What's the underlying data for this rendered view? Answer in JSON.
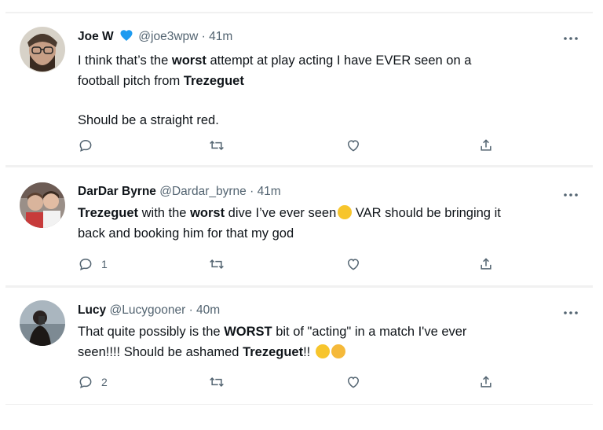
{
  "tweets": [
    {
      "name": "Joe W",
      "verified": true,
      "handle": "@joe3wpw",
      "sep": "·",
      "time": "41m",
      "line1_pre": "I think that’s the ",
      "line1_bold": "worst",
      "line1_post": " attempt at play acting I have EVER seen on a",
      "line2_pre": "football pitch from ",
      "line2_bold": "Trezeguet",
      "line3": "Should be a straight red.",
      "reply_count": "",
      "more_label": "···"
    },
    {
      "name": "DarDar Byrne",
      "verified": false,
      "handle": "@Dardar_byrne",
      "sep": "·",
      "time": "41m",
      "line1_bold1": "Trezeguet",
      "line1_mid": " with the ",
      "line1_bold2": "worst",
      "line1_post": " dive I’ve ever seen",
      "line1_emoji": "rolling-on-floor-laughing-emoji",
      "line1_end": " VAR should be bringing it",
      "line2": "back and booking him for that my god",
      "reply_count": "1",
      "more_label": "···"
    },
    {
      "name": "Lucy",
      "verified": false,
      "handle": "@Lucygooner",
      "sep": "·",
      "time": "40m",
      "line1_pre": "That quite possibly is the ",
      "line1_bold": "WORST",
      "line1_post": " bit of \"acting\" in a match I've ever",
      "line2_pre": "seen!!!! Should be ashamed ",
      "line2_bold": "Trezeguet",
      "line2_post": "!! ",
      "line2_emojis": [
        "face-screaming-emoji",
        "flushed-face-emoji"
      ],
      "reply_count": "2",
      "more_label": "···"
    }
  ],
  "colors": {
    "text": "#0f1419",
    "secondary": "#536471",
    "verified": "#1d9bf0",
    "divider": "#f1f1f1"
  },
  "icons": [
    "reply-icon",
    "retweet-icon",
    "like-icon",
    "share-icon",
    "verified-badge-icon",
    "more-icon"
  ]
}
